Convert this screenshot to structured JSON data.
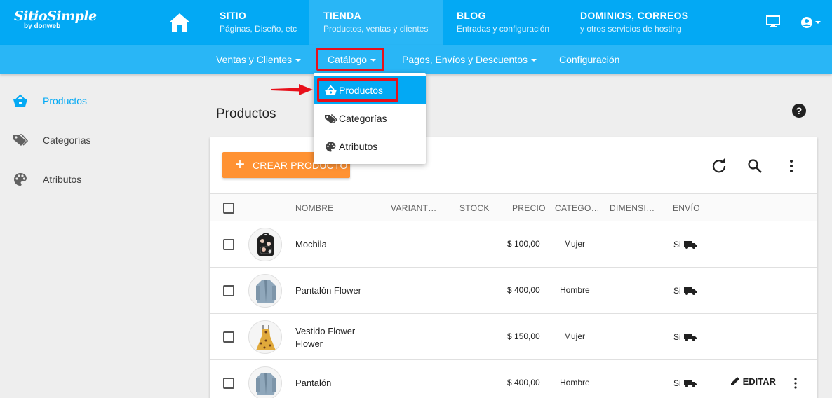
{
  "brand": {
    "name": "SitioSimple",
    "by": "by donweb"
  },
  "topnav": [
    {
      "title": "SITIO",
      "subtitle": "Páginas, Diseño, etc"
    },
    {
      "title": "TIENDA",
      "subtitle": "Productos, ventas y clientes"
    },
    {
      "title": "BLOG",
      "subtitle": "Entradas y configuración"
    },
    {
      "title": "DOMINIOS, CORREOS",
      "subtitle": "y otros servicios de hosting"
    }
  ],
  "subnav": [
    {
      "label": "Ventas y Clientes"
    },
    {
      "label": "Catálogo"
    },
    {
      "label": "Pagos, Envíos y Descuentos"
    },
    {
      "label": "Configuración"
    }
  ],
  "dropdown": [
    {
      "label": "Productos",
      "icon": "basket-icon"
    },
    {
      "label": "Categorías",
      "icon": "tag-icon"
    },
    {
      "label": "Atributos",
      "icon": "palette-icon"
    }
  ],
  "sidebar": [
    {
      "label": "Productos",
      "icon": "basket-icon"
    },
    {
      "label": "Categorías",
      "icon": "tag-icon"
    },
    {
      "label": "Atributos",
      "icon": "palette-icon"
    }
  ],
  "page": {
    "title": "Productos",
    "create_label": "CREAR PRODUCTO"
  },
  "table": {
    "headers": [
      "NOMBRE",
      "VARIANT…",
      "STOCK",
      "PRECIO",
      "CATEGO…",
      "DIMENSI…",
      "ENVÍO"
    ],
    "rows": [
      {
        "name_line1": "Mochila",
        "name_line2": "",
        "price": "$ 100,00",
        "category": "Mujer",
        "shipping": "Si"
      },
      {
        "name_line1": "Pantalón Flower",
        "name_line2": "",
        "price": "$ 400,00",
        "category": "Hombre",
        "shipping": "Si"
      },
      {
        "name_line1": "Vestido Flower",
        "name_line2": "Flower",
        "price": "$ 150,00",
        "category": "Mujer",
        "shipping": "Si"
      },
      {
        "name_line1": "Pantalón",
        "name_line2": "",
        "price": "$ 400,00",
        "category": "Hombre",
        "shipping": "Si"
      }
    ],
    "edit_label": "EDITAR"
  },
  "colors": {
    "primary": "#03a9f4",
    "primary_light": "#29b6f6",
    "accent": "#ff9233",
    "highlight": "#e8101a"
  }
}
